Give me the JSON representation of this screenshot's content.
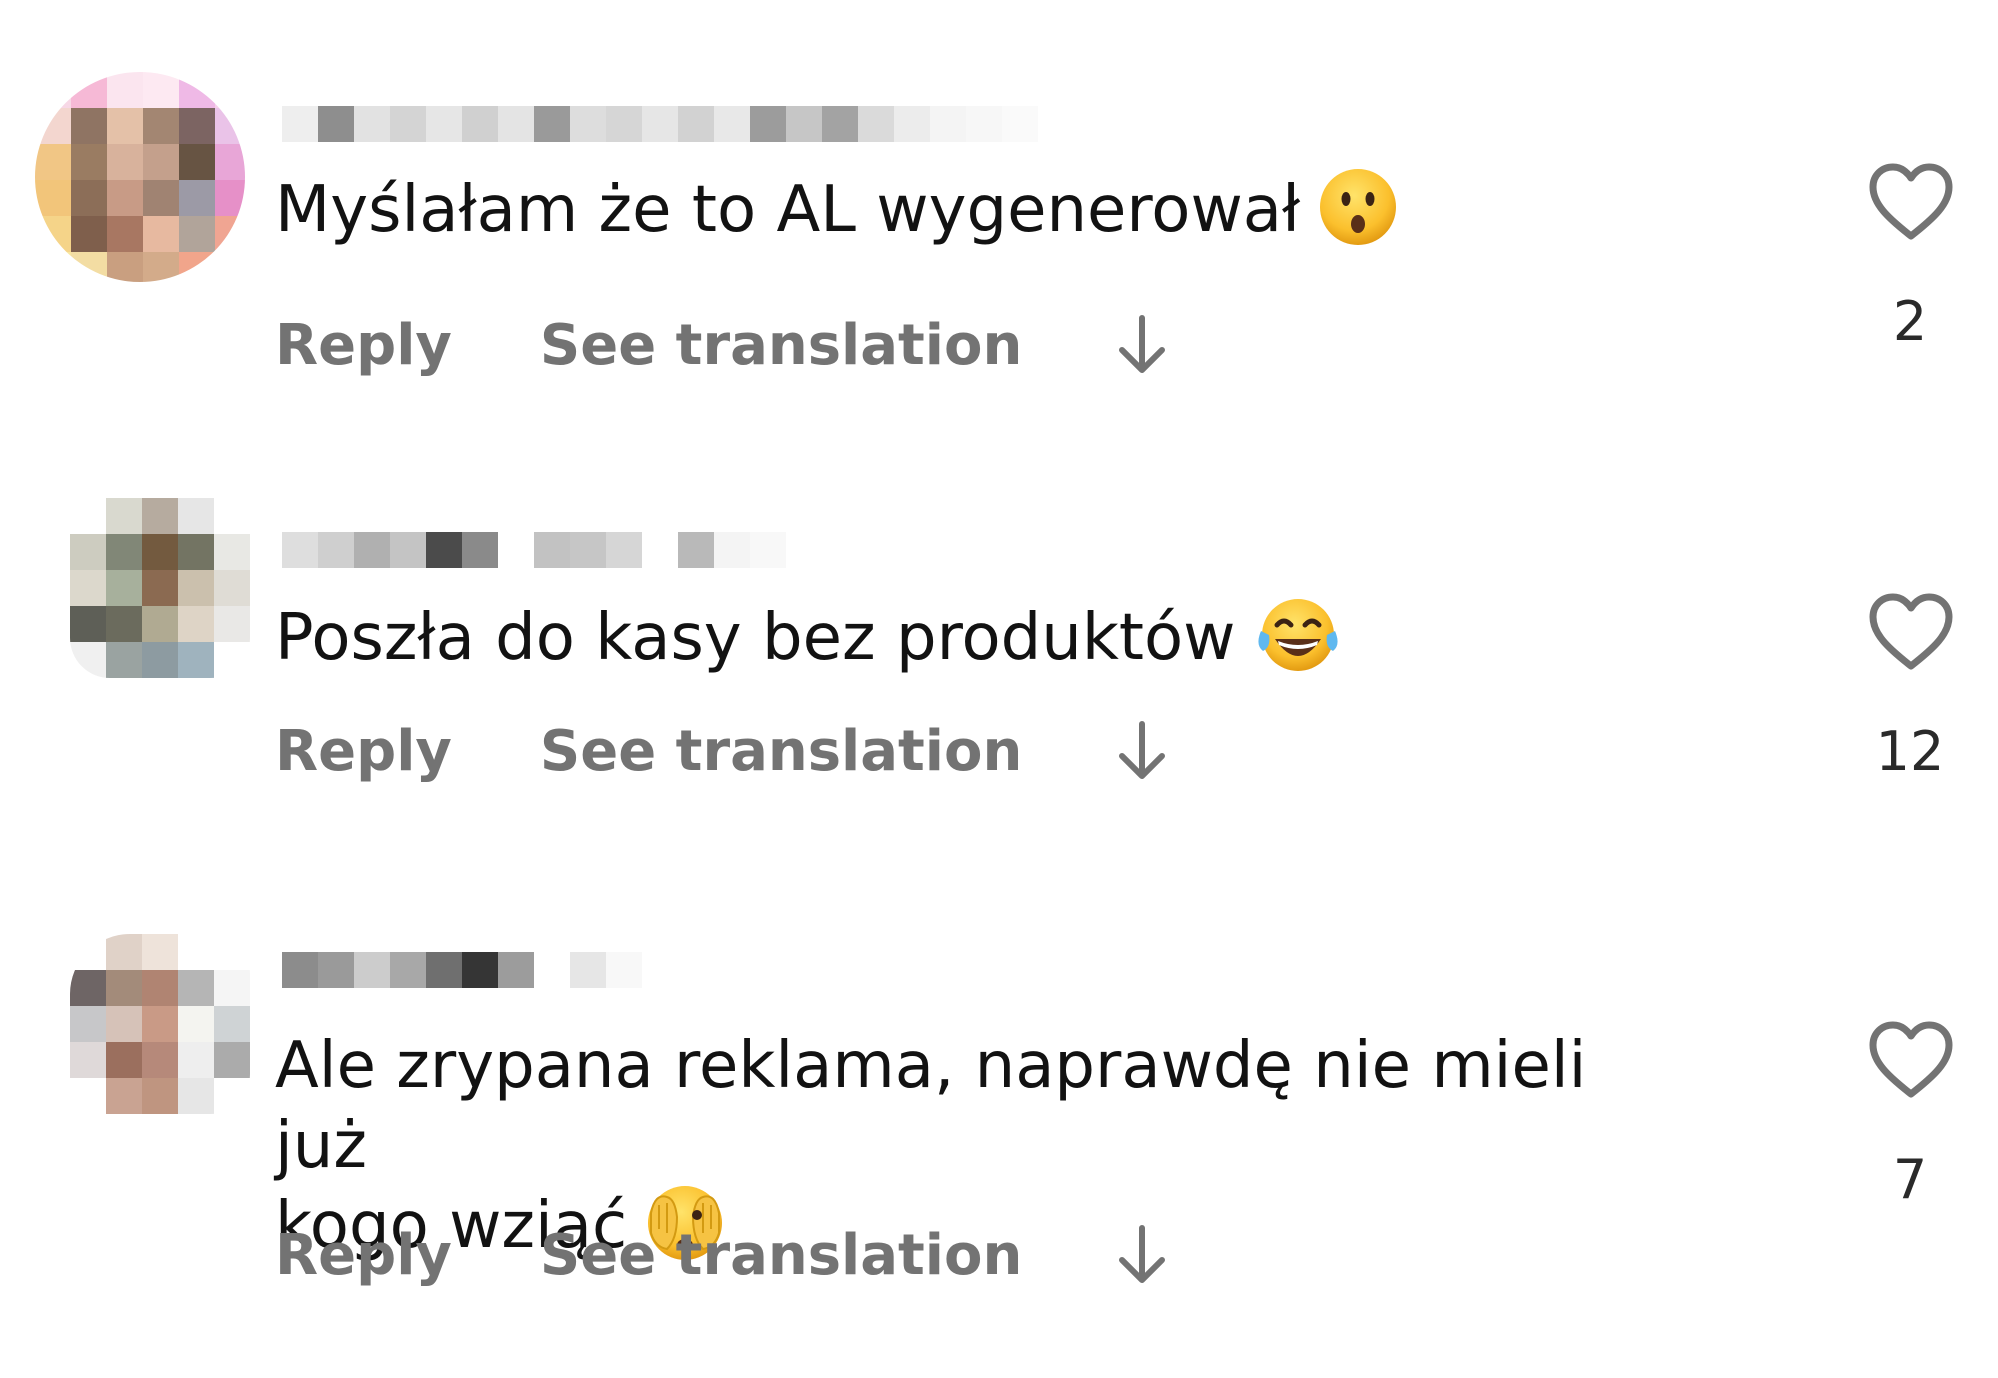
{
  "comments": [
    {
      "text": "Myślałam że to AL wygenerował",
      "emoji_icon": "hushed-face-emoji",
      "reply_label": "Reply",
      "translate_label": "See translation",
      "like_count": "2"
    },
    {
      "text": "Poszła do kasy bez produktów",
      "emoji_icon": "face-with-tears-of-joy-emoji",
      "reply_label": "Reply",
      "translate_label": "See translation",
      "like_count": "12"
    },
    {
      "text": "Ale zrypana reklama, naprawdę nie mieli już\nkogo wziąć",
      "emoji_icon": "face-with-hand-over-eyes-emoji",
      "reply_label": "Reply",
      "translate_label": "See translation",
      "like_count": "7"
    }
  ],
  "icons": {
    "like": "heart-outline-icon",
    "expand": "arrow-down-icon"
  },
  "colors": {
    "text": "#121212",
    "secondary": "#737373",
    "background": "#ffffff"
  }
}
